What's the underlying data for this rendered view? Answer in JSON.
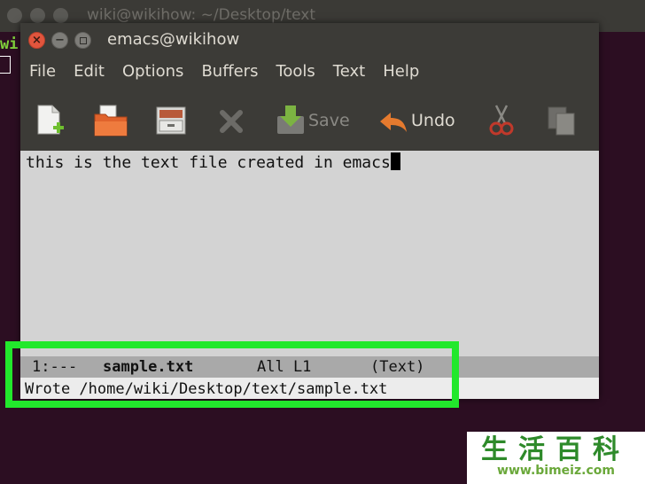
{
  "terminal": {
    "title": "wiki@wikihow: ~/Desktop/text",
    "prompt_fragment": "wi"
  },
  "window": {
    "title": "emacs@wikihow"
  },
  "menu": [
    "File",
    "Edit",
    "Options",
    "Buffers",
    "Tools",
    "Text",
    "Help"
  ],
  "toolbar": {
    "new_file_icon": "new-file-icon",
    "open_icon": "open-folder-icon",
    "dired_icon": "file-cabinet-icon",
    "close_icon": "close-x-icon",
    "save_label": "Save",
    "undo_label": "Undo",
    "cut_icon": "scissors-icon",
    "copy_icon": "copy-icon"
  },
  "buffer": {
    "text": "this is the text file created in emacs"
  },
  "mode_line": {
    "status": "1:---",
    "filename": "sample.txt",
    "position": "All L1",
    "mode": "(Text)"
  },
  "echo_area": {
    "message": "Wrote /home/wiki/Desktop/text/sample.txt"
  },
  "watermark": {
    "text": "生活百科",
    "url": "www.bimeiz.com"
  },
  "colors": {
    "highlight": "#22e82c",
    "terminal_bg": "#2c0e22",
    "window_bg": "#3c3b37",
    "close_button": "#e2553d",
    "watermark_green": "#6aa83a"
  }
}
